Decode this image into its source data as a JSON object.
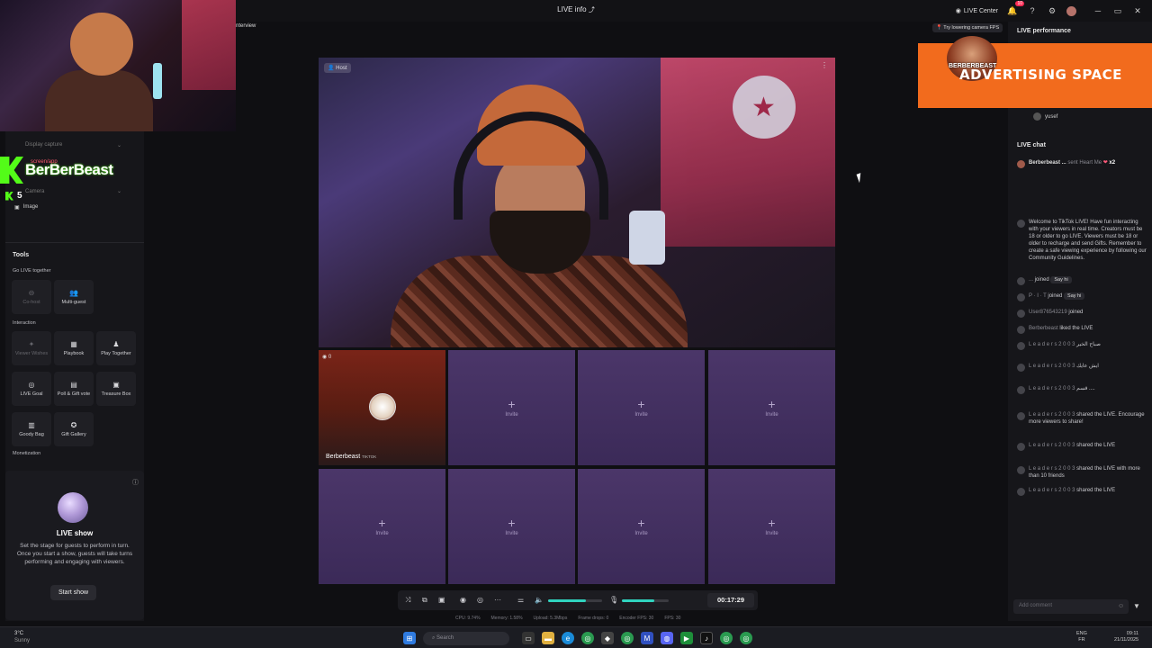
{
  "window": {
    "title": "LIVE info",
    "live_center": "LIVE Center",
    "notif_count": "10"
  },
  "overlay": {
    "brand_name": "BerBerBeast",
    "brand_count": "5",
    "partial_label": "nterview",
    "camera_tip": "Try lowering camera FPS",
    "ad_text": "ADVERTISING SPACE",
    "ad_label": "BERBERBEAST"
  },
  "sources": {
    "display_capture": "Display capture",
    "screen_app": "screen/app",
    "camera": "Camera",
    "image": "Image"
  },
  "tools": {
    "title": "Tools",
    "go_live_together": "Go LIVE together",
    "co_host": "Co-host",
    "multi_guest": "Multi-guest",
    "interaction": "Interaction",
    "viewer_wishes": "Viewer Wishes",
    "playbook": "Playbook",
    "play_together": "Play Together",
    "live_goal": "LIVE Goal",
    "poll_gift_vote": "Poll & Gift vote",
    "treasure_box": "Treasure Box",
    "goody_bag": "Goody Bag",
    "gift_gallery": "Gift Gallery",
    "monetization": "Monetization"
  },
  "live_show": {
    "title": "LIVE show",
    "description": "Set the stage for guests to perform in turn. Once you start a show, guests will take turns performing and engaging with viewers.",
    "button": "Start show"
  },
  "stage": {
    "host_tag": "Host",
    "guest_name": "Berberbeast",
    "guest_tag": "TIKTOK",
    "guest_count": "0",
    "invite_label": "Invite"
  },
  "controls": {
    "timer": "00:17:29",
    "stats": [
      "CPU: 9.74%",
      "Memory: 1.58%",
      "Upload: 5.3Mbps",
      "Frame drops: 0",
      "Encoder FPS: 30",
      "FPS: 30"
    ],
    "mic_level": 0.7,
    "speaker_level": 0.7
  },
  "right": {
    "performance": "LIVE performance",
    "viewer_name": "yusef",
    "chat_title": "LIVE chat",
    "top_gift": {
      "user": "Berberbeast ...",
      "text": "sent Heart Me",
      "count": "x2"
    },
    "welcome": "Welcome to TikTok LIVE! Have fun interacting with your viewers in real time. Creators must be 18 or older to go LIVE. Viewers must be 18 or older to recharge and send Gifts. Remember to create a safe viewing experience by following our Community Guidelines.",
    "messages": [
      {
        "user": "...",
        "text": "joined",
        "say_hi": "Say hi"
      },
      {
        "user": "P · I · T",
        "text": "joined",
        "say_hi": "Say hi"
      },
      {
        "user": "User876543219",
        "text": "joined"
      },
      {
        "user": "Berberbeast",
        "text": "liked the LIVE"
      },
      {
        "user": "L e a d e r s 2 0 0 3",
        "text": "صباح الخير"
      },
      {
        "user": "L e a d e r s 2 0 0 3",
        "text": "ايش عايك"
      },
      {
        "user": "L e a d e r s 2 0 0 3",
        "text": "قسم ...."
      },
      {
        "user": "L e a d e r s 2 0 0 3",
        "text": "shared the LIVE. Encourage more viewers to share!"
      },
      {
        "user": "L e a d e r s 2 0 0 3",
        "text": "shared the LIVE"
      },
      {
        "user": "L e a d e r s 2 0 0 3",
        "text": "shared the LIVE with more than 10 friends"
      },
      {
        "user": "L e a d e r s 2 0 0 3",
        "text": "shared the LIVE"
      }
    ],
    "comment_placeholder": "Add comment"
  },
  "taskbar": {
    "search": "Search",
    "weather": "3°C",
    "weather_sub": "Sunny",
    "time": "09:11",
    "date": "21/11/2025",
    "lang": "ENG",
    "lang_sub": "FR"
  },
  "colors": {
    "accent": "#30d4c0",
    "kick": "#53fc18",
    "ad": "#f26b1d",
    "cell": "#4b3669"
  }
}
